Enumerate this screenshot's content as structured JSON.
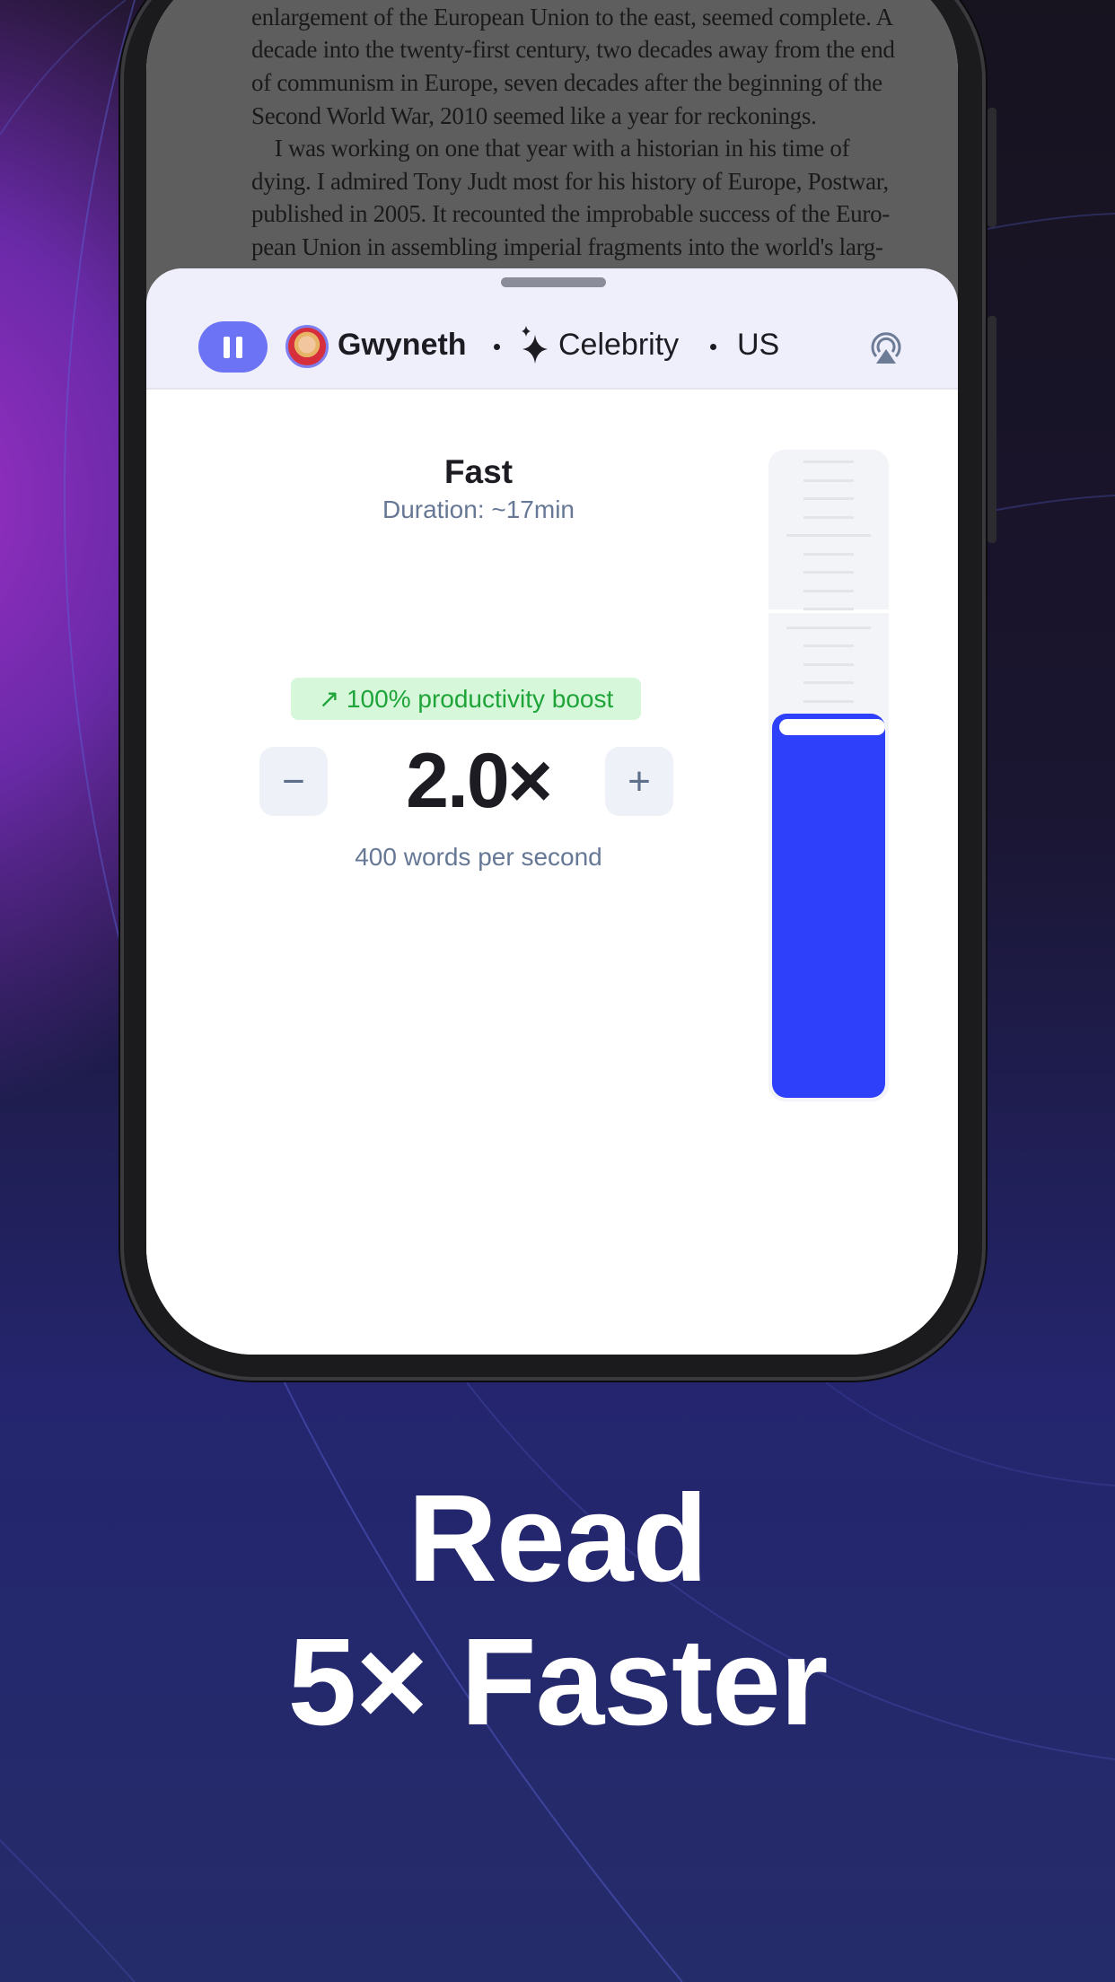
{
  "book_text": [
    "enlargement of the European Union to the east, seemed complete. A",
    "decade into the twenty-first century, two decades away from the end",
    "of communism in Europe, seven decades after the beginning of the",
    "Second World War, 2010 seemed like a year for reckonings.",
    "    I was working on one that year with a historian in his time of",
    "dying. I admired Tony Judt most for his history of Europe, Postwar,",
    "published in 2005. It recounted the improbable success of the Euro-",
    "pean Union in assembling imperial fragments into the world's larg-"
  ],
  "player": {
    "voice": "Gwyneth",
    "voice_type": "Celebrity",
    "accent": "US",
    "icons": {
      "pause": "pause-icon",
      "type": "sparkles-icon",
      "output": "airplay-icon"
    }
  },
  "speed": {
    "label": "Fast",
    "duration": "Duration: ~17min",
    "boost": "100% productivity boost",
    "value": "2.0×",
    "rate": "400 words per second",
    "slider_level_percent": 60,
    "accent": "#2f40fb",
    "minus": "−",
    "plus": "+"
  },
  "tagline": {
    "line1": "Read",
    "line2": "5× Faster"
  }
}
